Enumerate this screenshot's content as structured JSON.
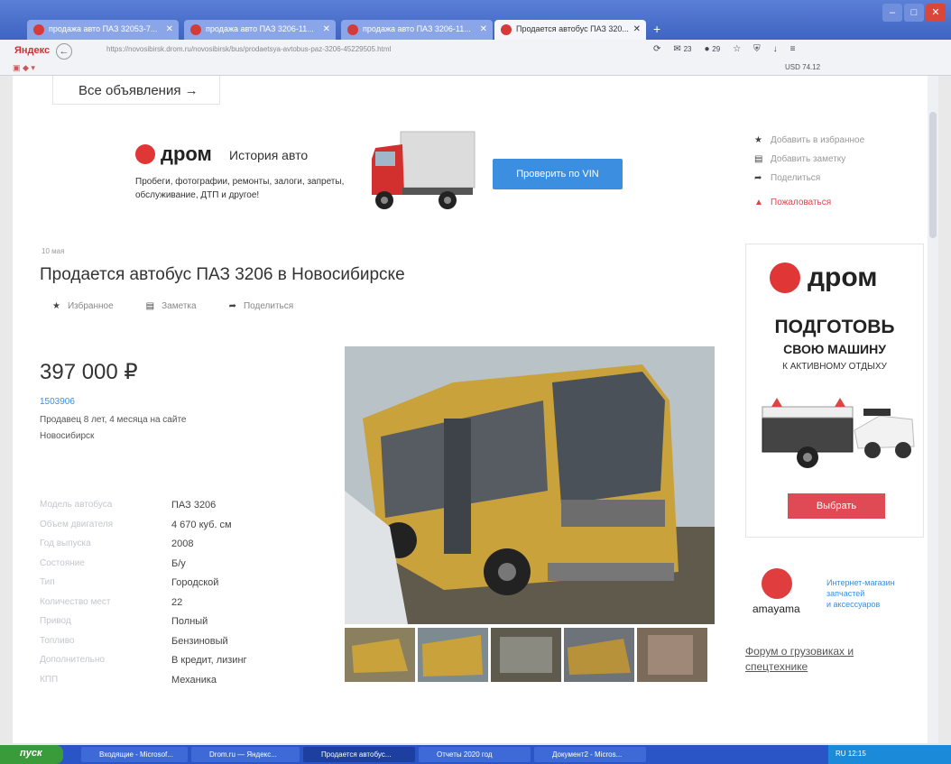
{
  "tabs": [
    {
      "title": "продажа авто ПАЗ 32053-7..."
    },
    {
      "title": "продажа авто ПАЗ 3206-11..."
    },
    {
      "title": "продажа авто ПАЗ 3206-11..."
    },
    {
      "title": "Продается автобус ПАЗ 320..."
    }
  ],
  "browser": {
    "logo": "Яндекс",
    "url": "https://novosibirsk.drom.ru/novosibirsk/bus/prodaetsya-avtobus-paz-3206-45229505.html",
    "mail_count": "23",
    "notif_count": "29",
    "currency": "USD 74.12"
  },
  "page": {
    "all_ads": "Все объявления →",
    "history": {
      "logo": "дром",
      "title": "История авто",
      "desc": "Пробеги, фотографии, ремонты, залоги, запреты, обслуживание, ДТП и другое!",
      "vin_button": "Проверить по VIN"
    },
    "date": "10 мая",
    "title": "Продается автобус ПАЗ 3206 в Новосибирске",
    "actions": {
      "favorite": "Избранное",
      "note": "Заметка",
      "share": "Поделиться"
    },
    "price": "397 000 ₽",
    "seller_id": "1503906",
    "seller_info": "Продавец 8 лет, 4 месяца на сайте",
    "city": "Новосибирск",
    "specs": [
      {
        "k": "Модель автобуса",
        "v": "ПАЗ 3206"
      },
      {
        "k": "Объем двигателя",
        "v": "4 670 куб. см"
      },
      {
        "k": "Год выпуска",
        "v": "2008"
      },
      {
        "k": "Состояние",
        "v": "Б/у"
      },
      {
        "k": "Тип",
        "v": "Городской"
      },
      {
        "k": "Количество мест",
        "v": "22"
      },
      {
        "k": "Привод",
        "v": "Полный"
      },
      {
        "k": "Топливо",
        "v": "Бензиновый"
      },
      {
        "k": "Дополнительно",
        "v": "В кредит, лизинг"
      },
      {
        "k": "КПП",
        "v": "Механика"
      }
    ]
  },
  "side": {
    "add_fav": "Добавить в избранное",
    "add_note": "Добавить заметку",
    "share": "Поделиться",
    "complain": "Пожаловаться",
    "ad": {
      "logo": "дром",
      "head1": "ПОДГОТОВЬ",
      "head2": "СВОЮ МАШИНУ",
      "head3": "К АКТИВНОМУ ОТДЫХУ",
      "button": "Выбрать"
    },
    "amayama": {
      "name": "amayama",
      "l1": "Интернет-магазин",
      "l2": "запчастей",
      "l3": "и аксессуаров"
    },
    "forum": "Форум о грузовиках и спецтехнике"
  },
  "taskbar": {
    "start": "пуск",
    "items": [
      "Входящие - Microsof...",
      "Drom.ru — Яндекс...",
      "Продается автобус...",
      "Отчеты 2020 год",
      "Документ2 - Micros..."
    ],
    "tray": "RU 12:15"
  }
}
